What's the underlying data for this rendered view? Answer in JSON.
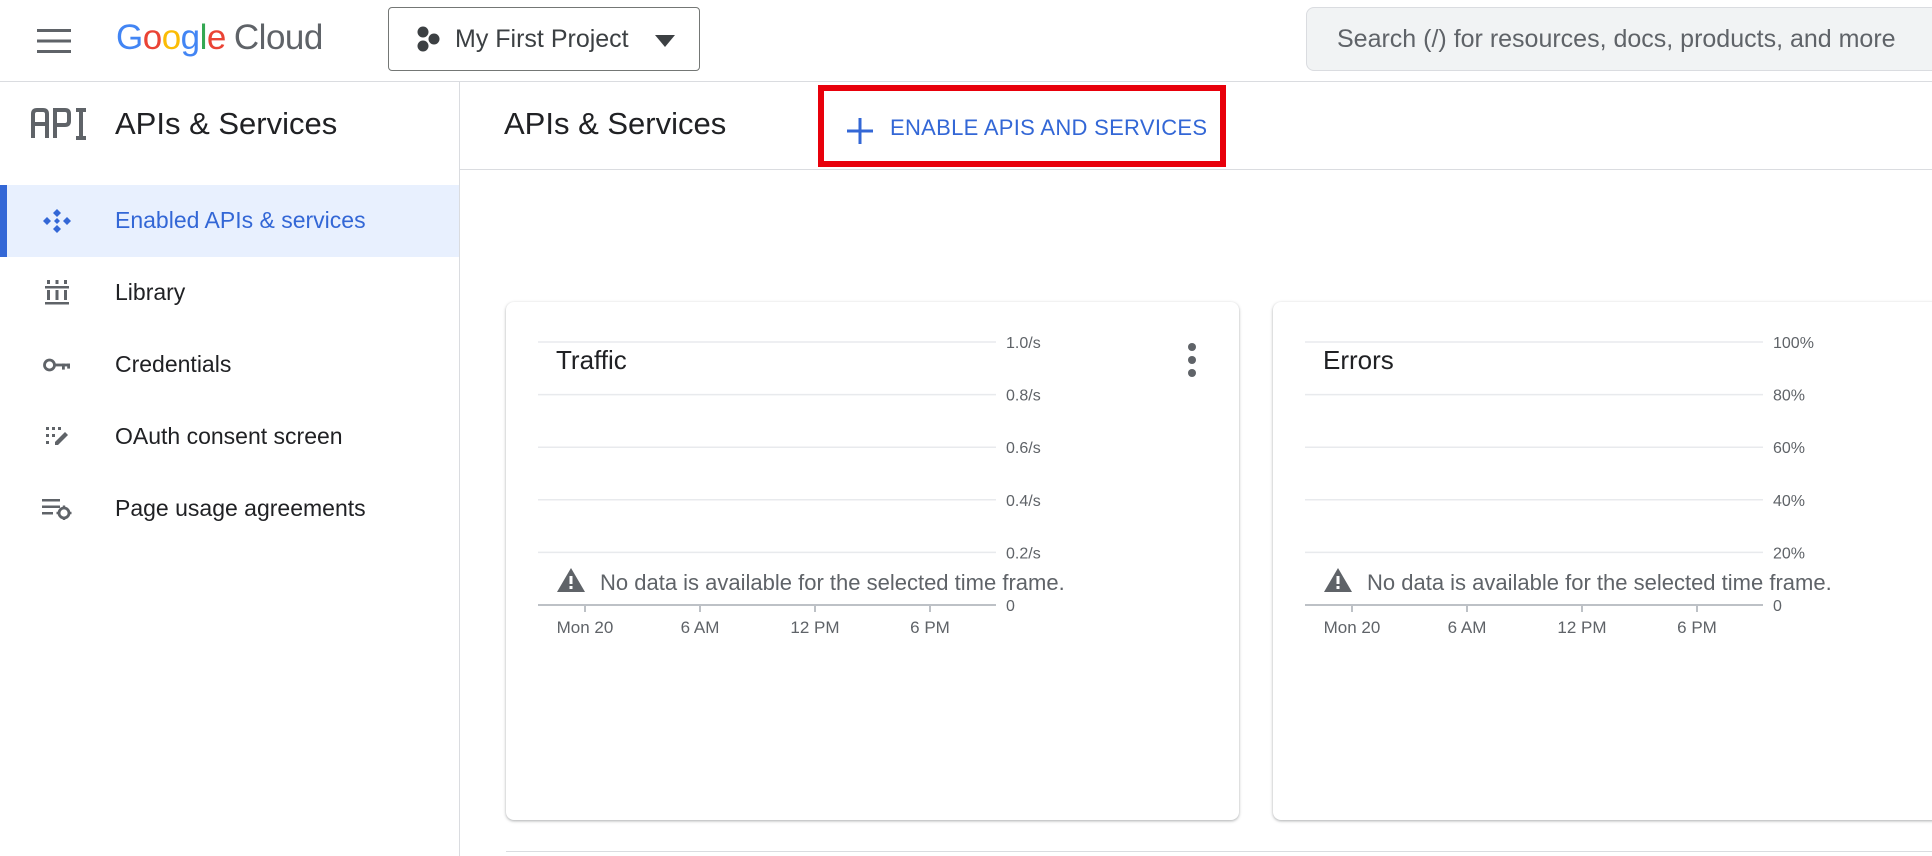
{
  "header": {
    "menu_icon": "hamburger-menu-icon",
    "logo": {
      "google": "Google",
      "cloud": "Cloud",
      "colors": [
        "#4285F4",
        "#EA4335",
        "#FBBC05",
        "#4285F4",
        "#34A853",
        "#EA4335"
      ]
    },
    "project": {
      "name": "My First Project",
      "icon": "project-hub-icon"
    },
    "search": {
      "placeholder": "Search (/) for resources, docs, products, and more"
    }
  },
  "sidebar": {
    "title": "APIs & Services",
    "logo_icon": "api-icon",
    "items": [
      {
        "label": "Enabled APIs & services",
        "icon": "enabled-apis-icon",
        "active": true
      },
      {
        "label": "Library",
        "icon": "library-icon",
        "active": false
      },
      {
        "label": "Credentials",
        "icon": "key-icon",
        "active": false
      },
      {
        "label": "OAuth consent screen",
        "icon": "oauth-consent-icon",
        "active": false
      },
      {
        "label": "Page usage agreements",
        "icon": "page-usage-settings-icon",
        "active": false
      }
    ]
  },
  "main": {
    "title": "APIs & Services",
    "enable_button": {
      "label": "ENABLE APIS AND SERVICES",
      "icon": "plus-icon",
      "highlight_color": "#e8000b"
    },
    "accent_color": "#3367d6"
  },
  "chart_data": [
    {
      "type": "line",
      "title": "Traffic",
      "x_ticks": [
        "Mon 20",
        "6 AM",
        "12 PM",
        "6 PM"
      ],
      "y_ticks": [
        "1.0/s",
        "0.8/s",
        "0.6/s",
        "0.4/s",
        "0.2/s",
        "0"
      ],
      "ylim": [
        0,
        1.0
      ],
      "series": [],
      "grid": true,
      "message": "No data is available for the selected time frame."
    },
    {
      "type": "line",
      "title": "Errors",
      "x_ticks": [
        "Mon 20",
        "6 AM",
        "12 PM",
        "6 PM"
      ],
      "y_ticks": [
        "100%",
        "80%",
        "60%",
        "40%",
        "20%",
        "0"
      ],
      "ylim": [
        0,
        100
      ],
      "series": [],
      "grid": true,
      "message": "No data is available for the selected time frame."
    }
  ]
}
